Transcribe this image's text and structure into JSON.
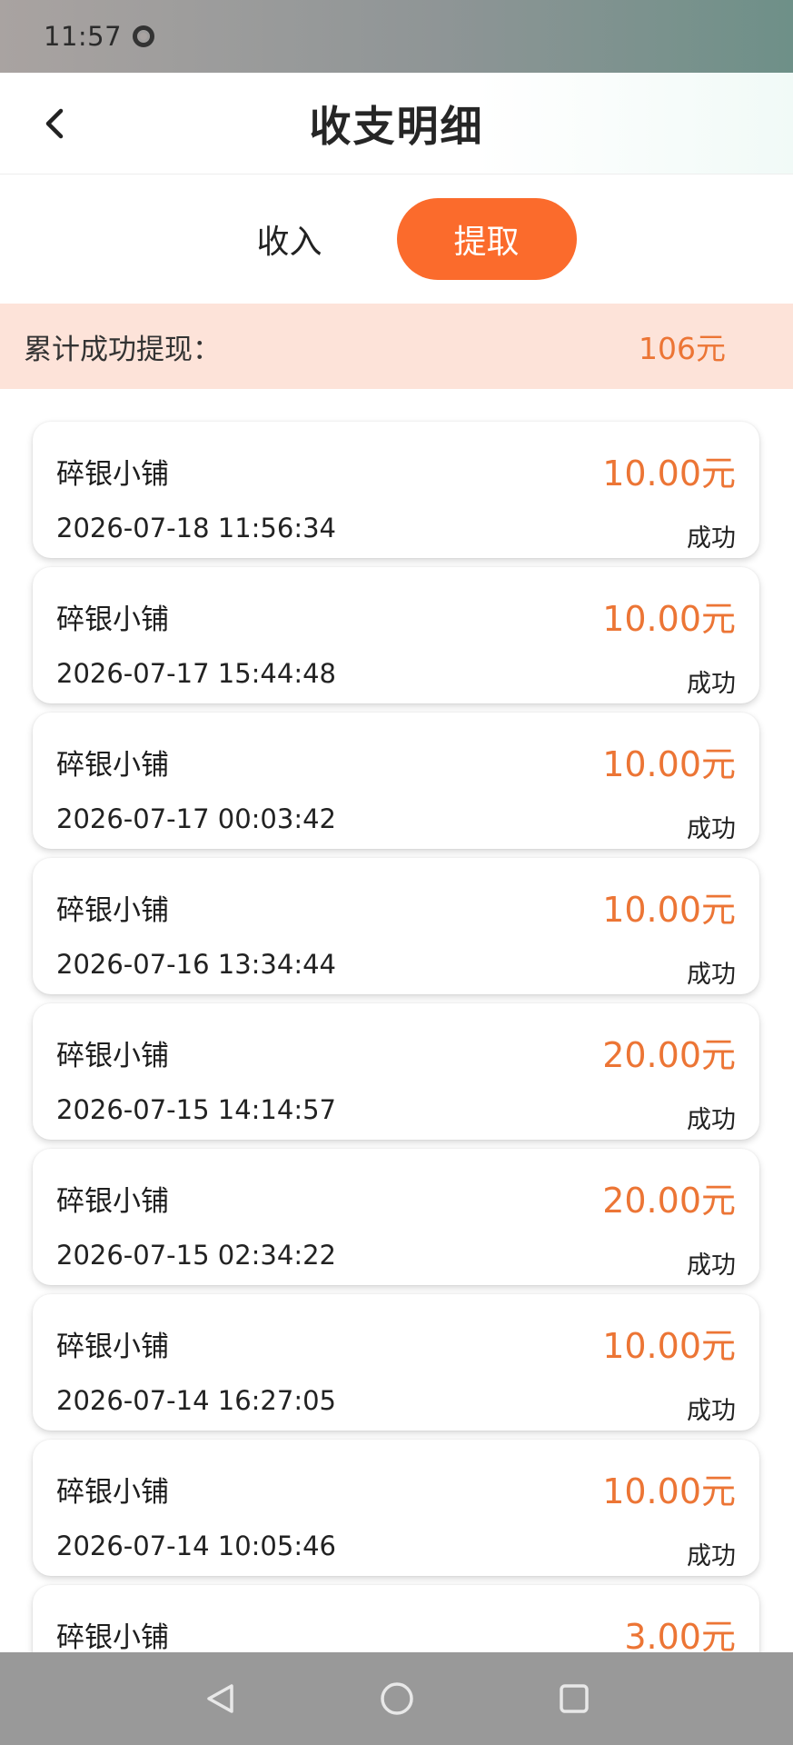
{
  "status_bar": {
    "time": "11:57"
  },
  "header": {
    "title": "收支明细"
  },
  "tabs": [
    {
      "label": "收入",
      "active": false
    },
    {
      "label": "提取",
      "active": true
    }
  ],
  "summary": {
    "label": "累计成功提现：",
    "value": "106元"
  },
  "records": [
    {
      "shop": "碎银小铺",
      "amount": "10.00元",
      "datetime": "2026-07-18 11:56:34",
      "status": "成功"
    },
    {
      "shop": "碎银小铺",
      "amount": "10.00元",
      "datetime": "2026-07-17 15:44:48",
      "status": "成功"
    },
    {
      "shop": "碎银小铺",
      "amount": "10.00元",
      "datetime": "2026-07-17 00:03:42",
      "status": "成功"
    },
    {
      "shop": "碎银小铺",
      "amount": "10.00元",
      "datetime": "2026-07-16 13:34:44",
      "status": "成功"
    },
    {
      "shop": "碎银小铺",
      "amount": "20.00元",
      "datetime": "2026-07-15 14:14:57",
      "status": "成功"
    },
    {
      "shop": "碎银小铺",
      "amount": "20.00元",
      "datetime": "2026-07-15 02:34:22",
      "status": "成功"
    },
    {
      "shop": "碎银小铺",
      "amount": "10.00元",
      "datetime": "2026-07-14 16:27:05",
      "status": "成功"
    },
    {
      "shop": "碎银小铺",
      "amount": "10.00元",
      "datetime": "2026-07-14 10:05:46",
      "status": "成功"
    },
    {
      "shop": "碎银小铺",
      "amount": "3.00元",
      "datetime": "",
      "status": ""
    }
  ],
  "colors": {
    "accent": "#fb6b2c",
    "amount": "#ec7535",
    "summary_bg": "#fde3d9"
  },
  "icons": {
    "back": "chevron-left-icon",
    "nav_back": "triangle-back-icon",
    "nav_home": "circle-home-icon",
    "nav_recents": "square-recents-icon"
  }
}
